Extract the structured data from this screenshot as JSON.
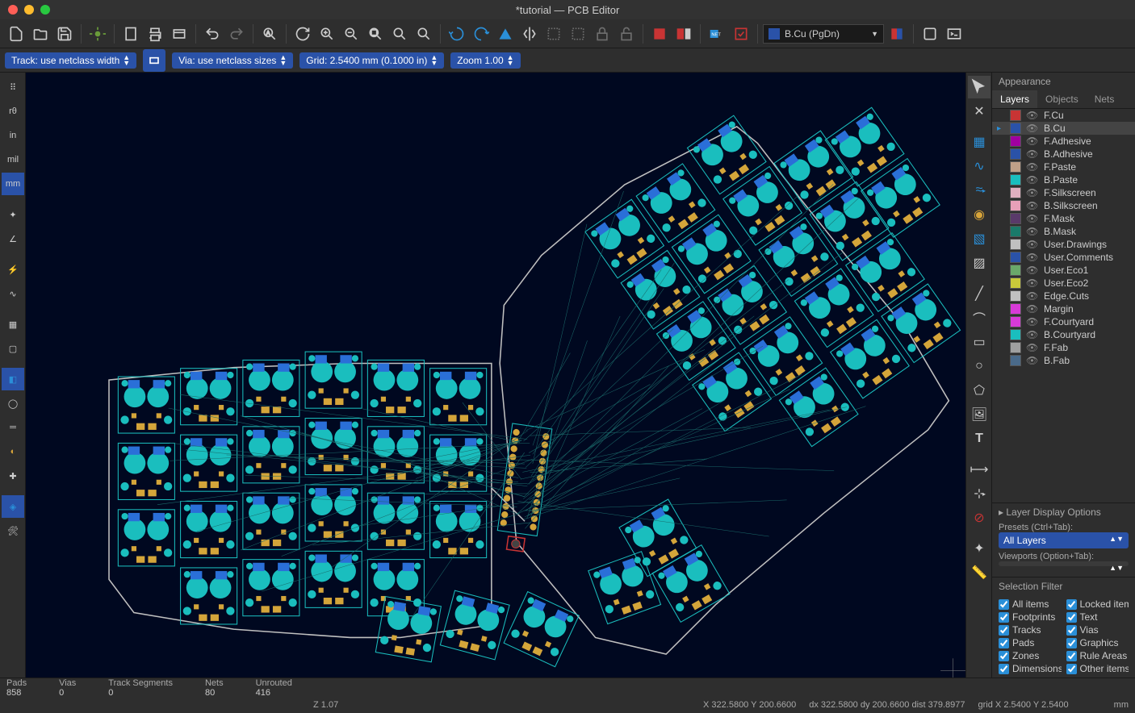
{
  "window": {
    "title": "*tutorial — PCB Editor"
  },
  "toolbar2": {
    "track": "Track: use netclass width",
    "via": "Via: use netclass sizes",
    "grid": "Grid: 2.5400 mm (0.1000 in)",
    "zoom": "Zoom 1.00"
  },
  "layer_select": {
    "label": "B.Cu (PgDn)",
    "color": "#2a52a8"
  },
  "appearance": {
    "title": "Appearance",
    "tabs": [
      "Layers",
      "Objects",
      "Nets"
    ],
    "active_tab": 0,
    "layers": [
      {
        "name": "F.Cu",
        "color": "#c83434"
      },
      {
        "name": "B.Cu",
        "color": "#2a52a8",
        "selected": true
      },
      {
        "name": "F.Adhesive",
        "color": "#a000a0"
      },
      {
        "name": "B.Adhesive",
        "color": "#2a52a8"
      },
      {
        "name": "F.Paste",
        "color": "#c0a088"
      },
      {
        "name": "B.Paste",
        "color": "#1abebe"
      },
      {
        "name": "F.Silkscreen",
        "color": "#e0b0c0"
      },
      {
        "name": "B.Silkscreen",
        "color": "#e8a0b8"
      },
      {
        "name": "F.Mask",
        "color": "#5a3a6a"
      },
      {
        "name": "B.Mask",
        "color": "#1a7a6a"
      },
      {
        "name": "User.Drawings",
        "color": "#c0c0c0"
      },
      {
        "name": "User.Comments",
        "color": "#2a52a8"
      },
      {
        "name": "User.Eco1",
        "color": "#6aa86a"
      },
      {
        "name": "User.Eco2",
        "color": "#c8c83a"
      },
      {
        "name": "Edge.Cuts",
        "color": "#c0c0c0"
      },
      {
        "name": "Margin",
        "color": "#d83ad8"
      },
      {
        "name": "F.Courtyard",
        "color": "#d83ad8"
      },
      {
        "name": "B.Courtyard",
        "color": "#1abebe"
      },
      {
        "name": "F.Fab",
        "color": "#a0a0a0"
      },
      {
        "name": "B.Fab",
        "color": "#4a6a8a"
      }
    ],
    "layer_display_options": "Layer Display Options",
    "presets_label": "Presets (Ctrl+Tab):",
    "presets_value": "All Layers",
    "viewports_label": "Viewports (Option+Tab):",
    "viewports_value": ""
  },
  "selection_filter": {
    "title": "Selection Filter",
    "items": [
      {
        "label": "All items",
        "checked": true
      },
      {
        "label": "Locked items",
        "checked": true
      },
      {
        "label": "Footprints",
        "checked": true
      },
      {
        "label": "Text",
        "checked": true
      },
      {
        "label": "Tracks",
        "checked": true
      },
      {
        "label": "Vias",
        "checked": true
      },
      {
        "label": "Pads",
        "checked": true
      },
      {
        "label": "Graphics",
        "checked": true
      },
      {
        "label": "Zones",
        "checked": true
      },
      {
        "label": "Rule Areas",
        "checked": true
      },
      {
        "label": "Dimensions",
        "checked": true
      },
      {
        "label": "Other items",
        "checked": true
      }
    ]
  },
  "status1": {
    "pads_label": "Pads",
    "pads_val": "858",
    "vias_label": "Vias",
    "vias_val": "0",
    "tracks_label": "Track Segments",
    "tracks_val": "0",
    "nets_label": "Nets",
    "nets_val": "80",
    "unrouted_label": "Unrouted",
    "unrouted_val": "416"
  },
  "status2": {
    "z": "Z 1.07",
    "xy": "X 322.5800  Y 200.6600",
    "dxy": "dx 322.5800  dy 200.6600  dist 379.8977",
    "grid": "grid X 2.5400  Y 2.5400",
    "unit": "mm"
  },
  "left_tools": [
    "grid",
    "polar",
    "in",
    "mil",
    "mm",
    "snap",
    "axis",
    "xy",
    "pline",
    "fill",
    "outline",
    "zone1",
    "zone2",
    "via-disp",
    "pad-disp",
    "cross",
    "layers",
    "tools"
  ],
  "right_tools": [
    "select",
    "anchor",
    "footprint",
    "route",
    "diff",
    "via",
    "zone",
    "rule",
    "line",
    "arc",
    "rect",
    "circle",
    "poly",
    "text",
    "dim",
    "align",
    "origin",
    "measure"
  ]
}
